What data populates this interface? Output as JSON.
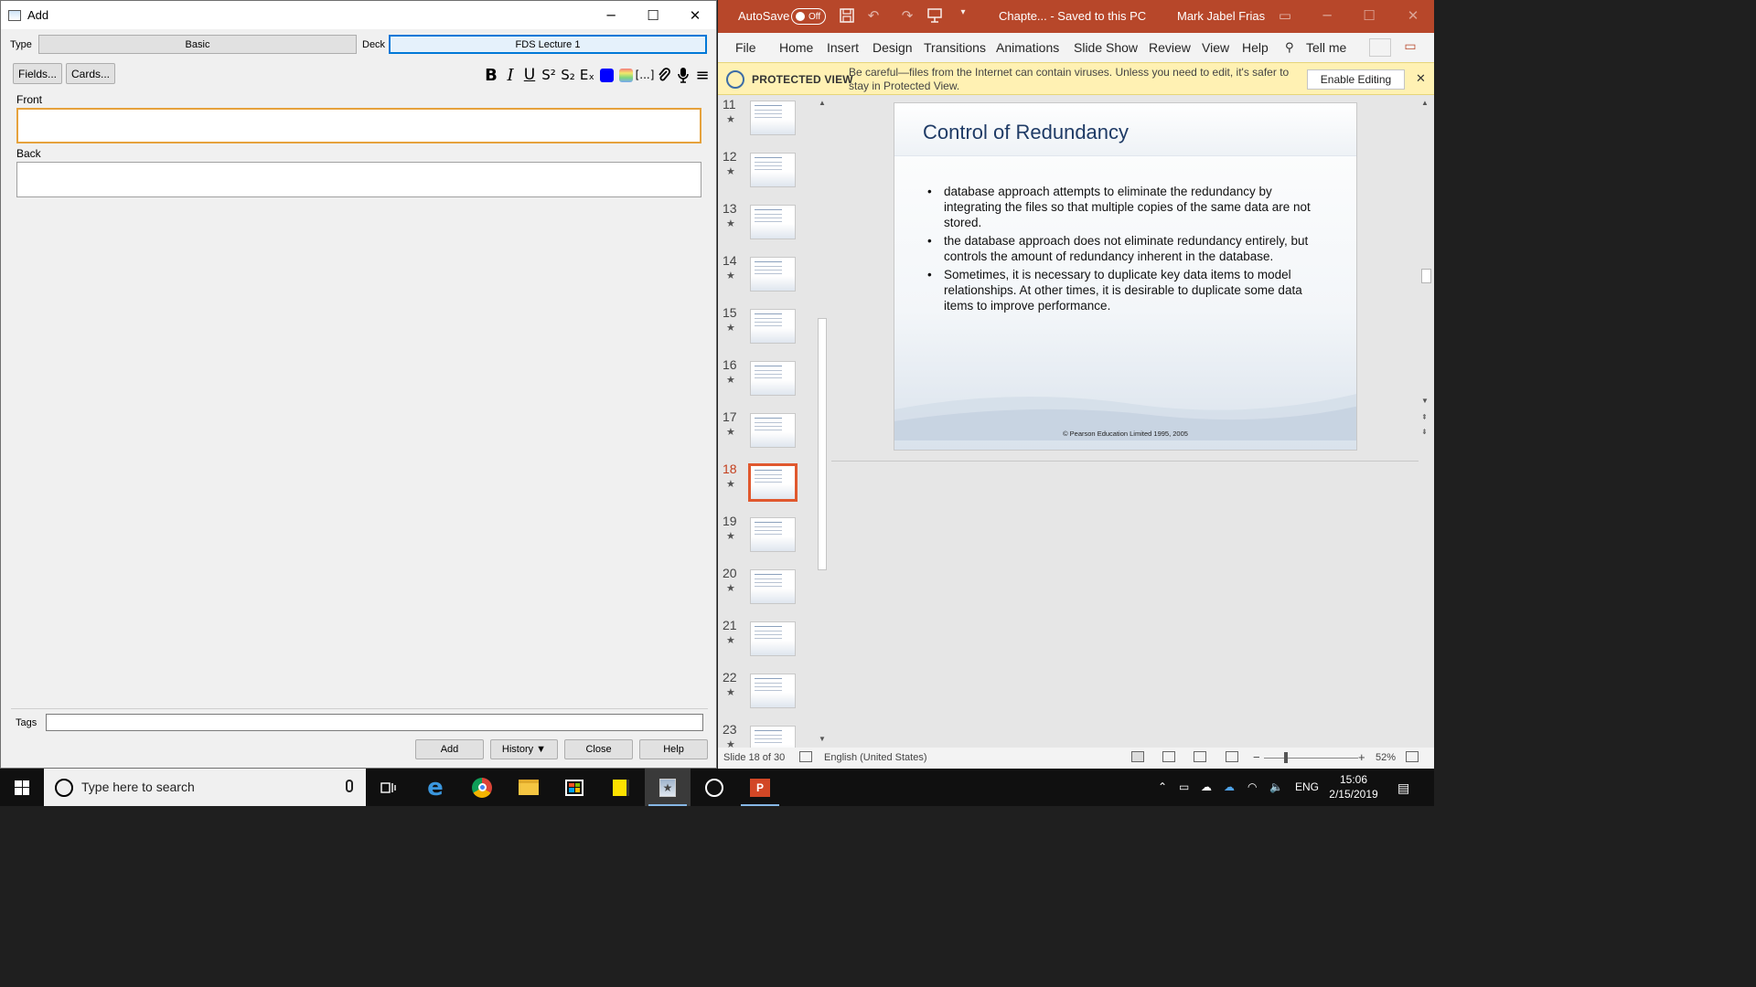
{
  "anki": {
    "window_title": "Add",
    "type_label": "Type",
    "type_value": "Basic",
    "deck_label": "Deck",
    "deck_value": "FDS Lecture 1",
    "fields_button": "Fields...",
    "cards_button": "Cards...",
    "format_icons": [
      "bold-icon",
      "italic-icon",
      "underline-icon",
      "superscript-icon",
      "subscript-icon",
      "clear-format-icon",
      "text-color-icon",
      "highlight-color-icon",
      "cloze-icon",
      "attach-icon",
      "record-audio-icon",
      "more-options-icon"
    ],
    "format_glyphs": {
      "bold": "B",
      "italic": "I",
      "underline": "U",
      "superscript": "S²",
      "subscript": "S₂",
      "clear": "Eₓ",
      "cloze": "[...]",
      "attach": "📎",
      "record": "🎙",
      "menu": "≡"
    },
    "text_color": "#0000ff",
    "front_label": "Front",
    "back_label": "Back",
    "front_value": "",
    "back_value": "",
    "tags_label": "Tags",
    "tags_value": "",
    "add_button": "Add",
    "history_button": "History ▼",
    "close_button": "Close",
    "help_button": "Help"
  },
  "ppt": {
    "autosave_label": "AutoSave",
    "autosave_state": "Off",
    "doc_title": "Chapte...  -  Saved to this PC",
    "user_name": "Mark Jabel Frias",
    "tabs": [
      "File",
      "Home",
      "Insert",
      "Design",
      "Transitions",
      "Animations",
      "Slide Show",
      "Review",
      "View",
      "Help",
      "Tell me"
    ],
    "protected_label": "PROTECTED VIEW",
    "protected_msg": "Be careful—files from the Internet can contain viruses. Unless you need to edit, it's safer to stay in Protected View.",
    "enable_editing": "Enable Editing",
    "thumbnails": [
      "11",
      "12",
      "13",
      "14",
      "15",
      "16",
      "17",
      "18",
      "19",
      "20",
      "21",
      "22",
      "23"
    ],
    "selected_slide": "18",
    "slide": {
      "title": "Control of Redundancy",
      "bullets": [
        "database approach attempts to eliminate the redundancy by integrating the files so that multiple copies of the same data are not stored.",
        "the database approach does not eliminate redundancy entirely, but controls the amount of redundancy inherent in the database.",
        "Sometimes, it is necessary to duplicate key data items to model relationships. At other times, it is desirable to duplicate some data items to improve performance."
      ],
      "footer": "© Pearson Education Limited 1995, 2005"
    },
    "status_slide": "Slide 18 of 30",
    "status_language": "English (United States)",
    "zoom": "52%",
    "accent": "#b7472a"
  },
  "taskbar": {
    "search_placeholder": "Type here to search",
    "language": "ENG",
    "time": "15:06",
    "date": "2/15/2019"
  }
}
